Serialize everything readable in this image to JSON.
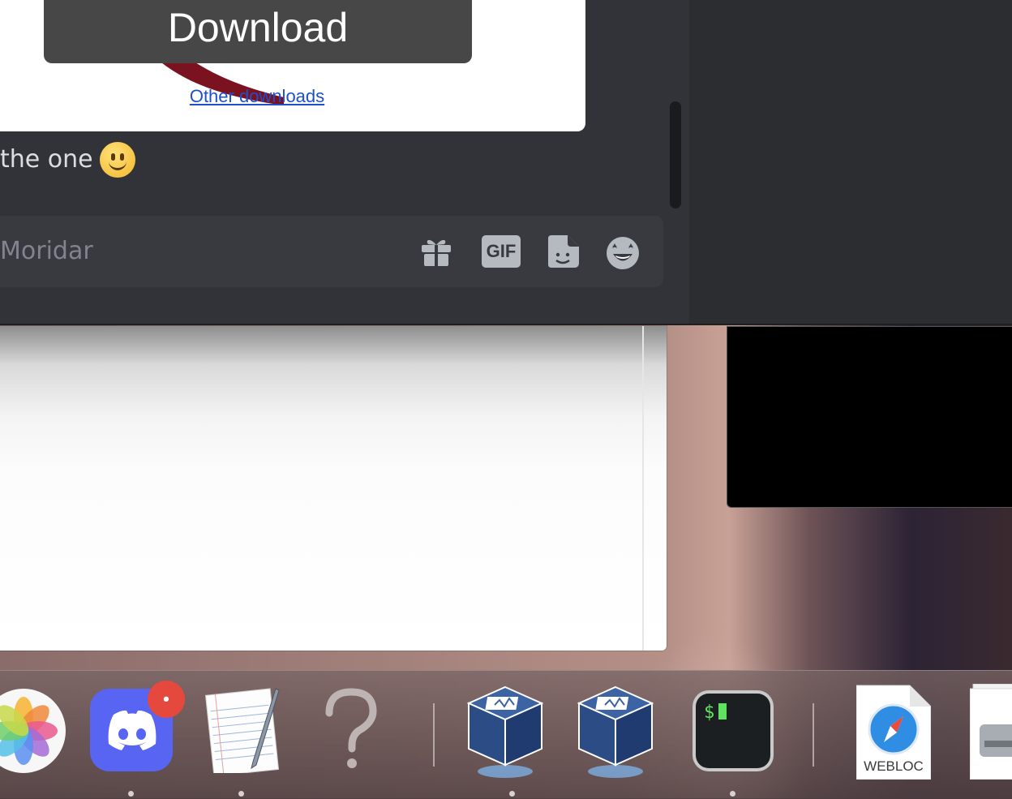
{
  "embed": {
    "download_label": "Download",
    "other_downloads_label": "Other downloads"
  },
  "message": {
    "text": "the one",
    "emoji": "slightly-smiling-face"
  },
  "composer": {
    "placeholder": "Moridar",
    "gif_label": "GIF",
    "icons": [
      "gift-icon",
      "gif-icon",
      "sticker-icon",
      "emoji-picker-icon"
    ]
  },
  "dock": {
    "items": [
      {
        "name": "photos-app",
        "running": false
      },
      {
        "name": "discord-app",
        "running": true,
        "badge": "•"
      },
      {
        "name": "textedit-app",
        "running": true
      },
      {
        "name": "unknown-app",
        "running": false
      },
      {
        "name": "virtualbox-app-1",
        "running": true
      },
      {
        "name": "virtualbox-app-2",
        "running": false
      },
      {
        "name": "terminal-app",
        "running": true,
        "prompt": "$"
      },
      {
        "name": "webloc-file",
        "label": "WEBLOC"
      },
      {
        "name": "disk-image-file"
      }
    ]
  },
  "colors": {
    "discord_bg": "#313338",
    "discord_sidebar": "#2b2d31",
    "composer_bg": "#383a40",
    "link_blue": "#1f4fcc",
    "badge_red": "#e5483d"
  }
}
